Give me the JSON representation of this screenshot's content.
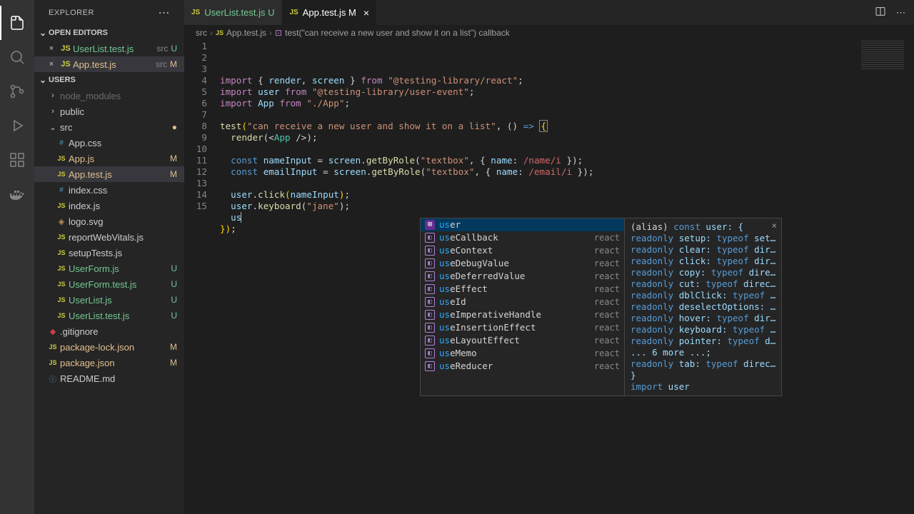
{
  "sidebar": {
    "title": "EXPLORER",
    "sections": {
      "openEditors": {
        "label": "OPEN EDITORS",
        "items": [
          {
            "name": "UserList.test.js",
            "path": "src",
            "status": "U"
          },
          {
            "name": "App.test.js",
            "path": "src",
            "status": "M",
            "active": true
          }
        ]
      },
      "project": {
        "label": "USERS",
        "tree": [
          {
            "type": "folder",
            "name": "node_modules",
            "depth": 1,
            "expanded": false,
            "dim": true
          },
          {
            "type": "folder",
            "name": "public",
            "depth": 1,
            "expanded": false
          },
          {
            "type": "folder",
            "name": "src",
            "depth": 1,
            "expanded": true,
            "modified": true
          },
          {
            "type": "file",
            "name": "App.css",
            "depth": 2,
            "icon": "css"
          },
          {
            "type": "file",
            "name": "App.js",
            "depth": 2,
            "icon": "js",
            "status": "M"
          },
          {
            "type": "file",
            "name": "App.test.js",
            "depth": 2,
            "icon": "js",
            "status": "M",
            "active": true
          },
          {
            "type": "file",
            "name": "index.css",
            "depth": 2,
            "icon": "css"
          },
          {
            "type": "file",
            "name": "index.js",
            "depth": 2,
            "icon": "js"
          },
          {
            "type": "file",
            "name": "logo.svg",
            "depth": 2,
            "icon": "svg"
          },
          {
            "type": "file",
            "name": "reportWebVitals.js",
            "depth": 2,
            "icon": "js"
          },
          {
            "type": "file",
            "name": "setupTests.js",
            "depth": 2,
            "icon": "js"
          },
          {
            "type": "file",
            "name": "UserForm.js",
            "depth": 2,
            "icon": "js",
            "status": "U"
          },
          {
            "type": "file",
            "name": "UserForm.test.js",
            "depth": 2,
            "icon": "js",
            "status": "U"
          },
          {
            "type": "file",
            "name": "UserList.js",
            "depth": 2,
            "icon": "js",
            "status": "U"
          },
          {
            "type": "file",
            "name": "UserList.test.js",
            "depth": 2,
            "icon": "js",
            "status": "U"
          },
          {
            "type": "file",
            "name": ".gitignore",
            "depth": 1,
            "icon": "git"
          },
          {
            "type": "file",
            "name": "package-lock.json",
            "depth": 1,
            "icon": "json",
            "status": "M"
          },
          {
            "type": "file",
            "name": "package.json",
            "depth": 1,
            "icon": "json",
            "status": "M"
          },
          {
            "type": "file",
            "name": "README.md",
            "depth": 1,
            "icon": "md"
          }
        ]
      }
    }
  },
  "tabs": [
    {
      "name": "UserList.test.js",
      "status": "U",
      "dirty": false
    },
    {
      "name": "App.test.js",
      "status": "M",
      "dirty": false,
      "active": true
    }
  ],
  "breadcrumb": {
    "parts": [
      "src",
      "App.test.js",
      "test(\"can receive a new user and show it on a list\") callback"
    ]
  },
  "code": {
    "lines": [
      {
        "n": 1,
        "t": "import { render, screen } from \"@testing-library/react\";"
      },
      {
        "n": 2,
        "t": "import user from \"@testing-library/user-event\";"
      },
      {
        "n": 3,
        "t": "import App from \"./App\";"
      },
      {
        "n": 4,
        "t": ""
      },
      {
        "n": 5,
        "t": "test(\"can receive a new user and show it on a list\", () => {"
      },
      {
        "n": 6,
        "t": "  render(<App />);"
      },
      {
        "n": 7,
        "t": ""
      },
      {
        "n": 8,
        "t": "  const nameInput = screen.getByRole(\"textbox\", { name: /name/i });"
      },
      {
        "n": 9,
        "t": "  const emailInput = screen.getByRole(\"textbox\", { name: /email/i });"
      },
      {
        "n": 10,
        "t": ""
      },
      {
        "n": 11,
        "t": "  user.click(nameInput);"
      },
      {
        "n": 12,
        "t": "  user.keyboard(\"jane\");"
      },
      {
        "n": 13,
        "t": "  us"
      },
      {
        "n": 14,
        "t": "});"
      },
      {
        "n": 15,
        "t": ""
      }
    ]
  },
  "suggest": {
    "items": [
      {
        "label": "user",
        "detail": "",
        "kind": "local",
        "selected": true
      },
      {
        "label": "useCallback",
        "detail": "react",
        "kind": "method"
      },
      {
        "label": "useContext",
        "detail": "react",
        "kind": "method"
      },
      {
        "label": "useDebugValue",
        "detail": "react",
        "kind": "method"
      },
      {
        "label": "useDeferredValue",
        "detail": "react",
        "kind": "method"
      },
      {
        "label": "useEffect",
        "detail": "react",
        "kind": "method"
      },
      {
        "label": "useId",
        "detail": "react",
        "kind": "method"
      },
      {
        "label": "useImperativeHandle",
        "detail": "react",
        "kind": "method"
      },
      {
        "label": "useInsertionEffect",
        "detail": "react",
        "kind": "method"
      },
      {
        "label": "useLayoutEffect",
        "detail": "react",
        "kind": "method"
      },
      {
        "label": "useMemo",
        "detail": "react",
        "kind": "method"
      },
      {
        "label": "useReducer",
        "detail": "react",
        "kind": "method"
      }
    ],
    "detail": [
      "(alias) const user: {",
      "    readonly setup: typeof set…",
      "    readonly clear: typeof dir…",
      "    readonly click: typeof dir…",
      "    readonly copy: typeof dire…",
      "    readonly cut: typeof direc…",
      "    readonly dblClick: typeof …",
      "    readonly deselectOptions: …",
      "    readonly hover: typeof dir…",
      "    readonly keyboard: typeof …",
      "    readonly pointer: typeof d…",
      "    ... 6 more ...;",
      "    readonly tab: typeof direc…",
      "}",
      "import user"
    ]
  }
}
